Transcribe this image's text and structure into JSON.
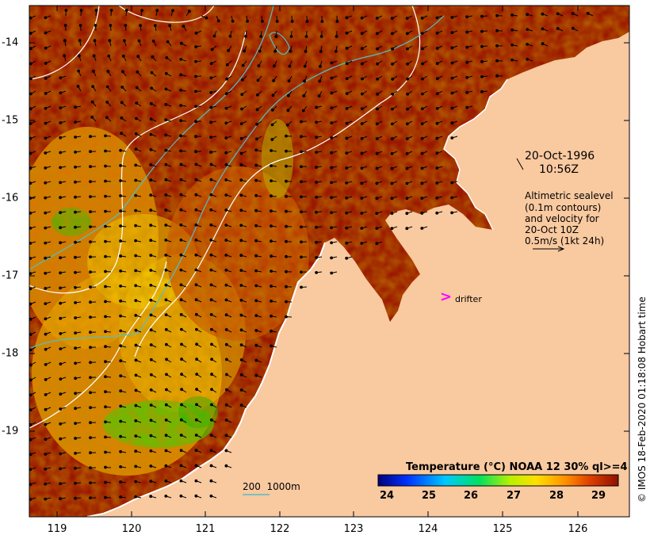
{
  "map": {
    "x_ticks": [
      "119",
      "120",
      "121",
      "122",
      "123",
      "124",
      "125",
      "126"
    ],
    "y_ticks": [
      "-14",
      "-15",
      "-16",
      "-17",
      "-18",
      "-19"
    ],
    "date": "20-Oct-1996",
    "time": "10:56Z",
    "legend_lines": [
      "Altimetric sealevel",
      "(0.1m contours)",
      "and velocity for",
      "20-Oct 10Z",
      "0.5m/s (1kt 24h)"
    ],
    "drifter_label": "drifter",
    "drifter_marker": ">",
    "depth_label": "200  1000m",
    "credit": "© IMOS 18-Feb-2020 01:18:08 Hobart time",
    "colorbar": {
      "title": "Temperature (°C) NOAA 12 30% ql>=4",
      "ticks": [
        "24",
        "25",
        "26",
        "27",
        "28",
        "29"
      ]
    },
    "colors": {
      "land": "#f9c9a0",
      "sea_hot": "#9a1800",
      "contour": "#ffffff",
      "isobath": "#50c0c8",
      "drifter": "#ff00ff"
    }
  }
}
